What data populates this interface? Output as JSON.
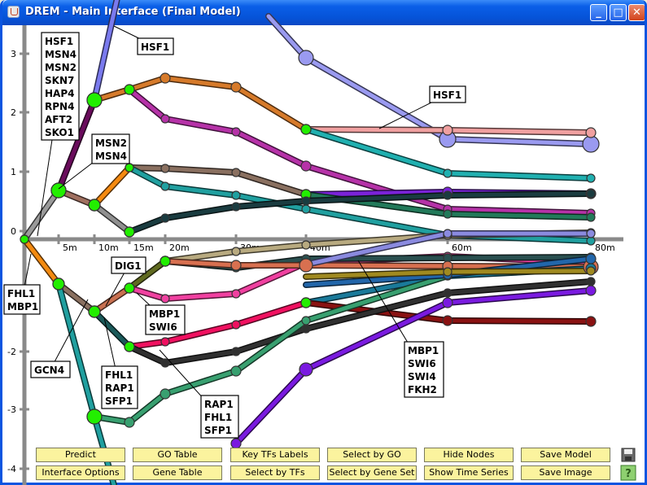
{
  "window": {
    "title": "DREM - Main Interface (Final Model)",
    "minimize": "_",
    "maximize": "□",
    "close": "✕"
  },
  "y_ticks": [
    "3",
    "2",
    "1",
    "0",
    "-1",
    "-2",
    "-3",
    "-4"
  ],
  "x_ticks": [
    "5m",
    "10m",
    "15m",
    "20m",
    "30m",
    "40m",
    "60m",
    "80m"
  ],
  "tf_labels": [
    {
      "lines": [
        "HSF1"
      ]
    },
    {
      "lines": [
        "HSF1",
        "MSN4",
        "MSN2",
        "SKN7",
        "HAP4",
        "RPN4",
        "AFT2",
        "SKO1"
      ]
    },
    {
      "lines": [
        "HSF1"
      ]
    },
    {
      "lines": [
        "MSN2",
        "MSN4"
      ]
    },
    {
      "lines": [
        "FHL1",
        "MBP1"
      ]
    },
    {
      "lines": [
        "DIG1"
      ]
    },
    {
      "lines": [
        "MBP1",
        "SWI6"
      ]
    },
    {
      "lines": [
        "GCN4"
      ]
    },
    {
      "lines": [
        "FHL1",
        "RAP1",
        "SFP1"
      ]
    },
    {
      "lines": [
        "RAP1",
        "FHL1",
        "SFP1"
      ]
    },
    {
      "lines": [
        "MBP1",
        "SWI6",
        "SWI4",
        "FKH2"
      ]
    }
  ],
  "buttons": {
    "row1": [
      "Predict",
      "GO Table",
      "Key TFs Labels",
      "Select by GO",
      "Hide Nodes",
      "Save Model"
    ],
    "row2": [
      "Interface Options",
      "Gene Table",
      "Select by TFs",
      "Select by Gene Set",
      "Show Time Series",
      "Save Image"
    ]
  },
  "icons": {
    "save": "save-icon",
    "help": "help-icon"
  },
  "colors": {
    "title_bar": "#0a5fe8",
    "button_bg": "#fbf39e",
    "split_node": "#22ee00",
    "axis": "#8a8a8a"
  }
}
